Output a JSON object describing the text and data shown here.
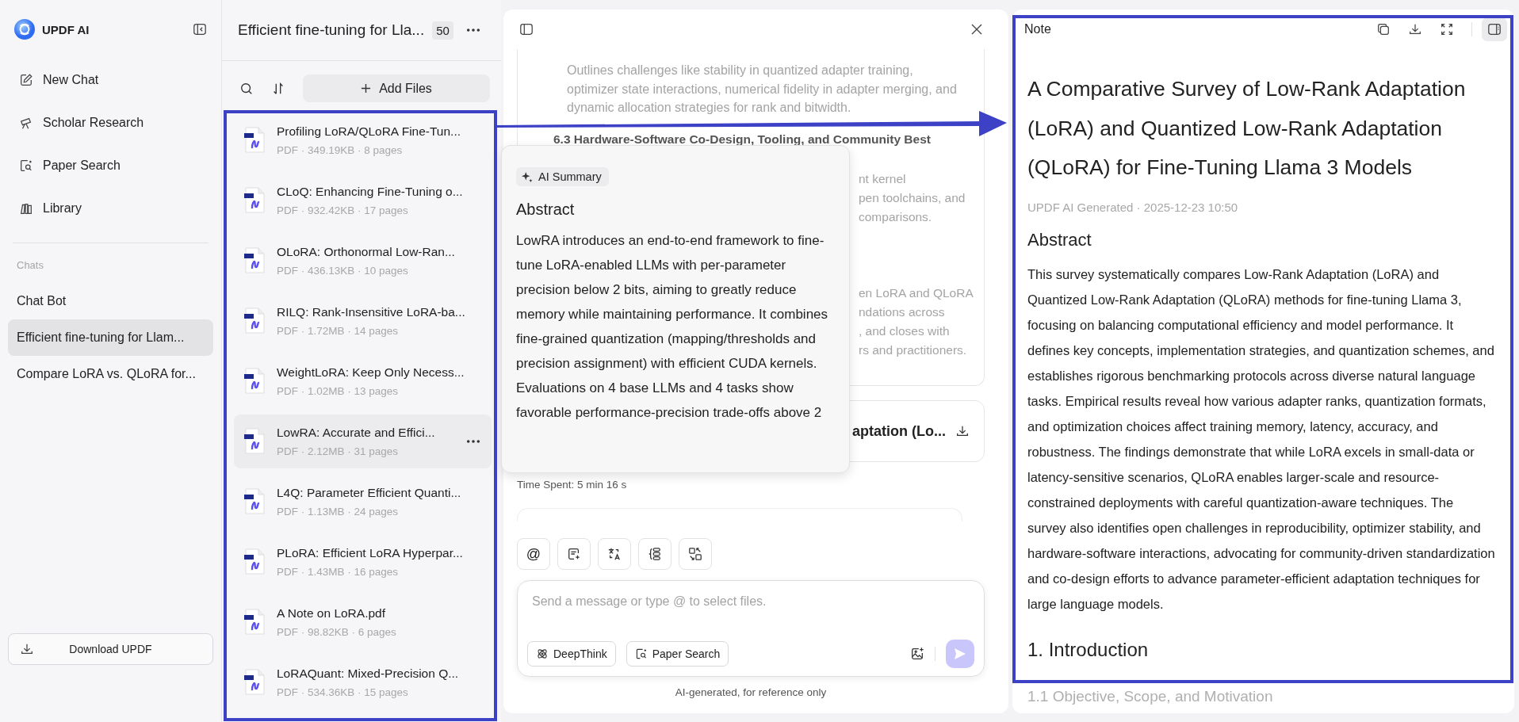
{
  "sidebar": {
    "app_name": "UPDF AI",
    "nav": [
      {
        "label": "New Chat"
      },
      {
        "label": "Scholar Research"
      },
      {
        "label": "Paper Search"
      },
      {
        "label": "Library"
      }
    ],
    "chats_label": "Chats",
    "chats": [
      {
        "label": "Chat Bot",
        "selected": false
      },
      {
        "label": "Efficient fine-tuning for Llam...",
        "selected": true
      },
      {
        "label": "Compare LoRA vs. QLoRA for...",
        "selected": false
      }
    ],
    "download_button": "Download UPDF"
  },
  "file_list": {
    "title": "Efficient fine-tuning for Lla...",
    "count": "50",
    "add_button": "Add Files",
    "files": [
      {
        "name": "Profiling LoRA/QLoRA Fine-Tun...",
        "meta": "PDF · 349.19KB · 8 pages",
        "selected": false
      },
      {
        "name": "CLoQ: Enhancing Fine-Tuning o...",
        "meta": "PDF · 932.42KB · 17 pages",
        "selected": false
      },
      {
        "name": "OLoRA: Orthonormal Low-Ran...",
        "meta": "PDF · 436.13KB · 10 pages",
        "selected": false
      },
      {
        "name": "RILQ: Rank-Insensitive LoRA-ba...",
        "meta": "PDF · 1.72MB · 14 pages",
        "selected": false
      },
      {
        "name": "WeightLoRA: Keep Only Necess...",
        "meta": "PDF · 1.02MB · 13 pages",
        "selected": false
      },
      {
        "name": "LowRA: Accurate and Effici...",
        "meta": "PDF · 2.12MB · 31 pages",
        "selected": true
      },
      {
        "name": "L4Q: Parameter Efficient Quanti...",
        "meta": "PDF · 1.13MB · 24 pages",
        "selected": false
      },
      {
        "name": "PLoRA: Efficient LoRA Hyperpar...",
        "meta": "PDF · 1.43MB · 16 pages",
        "selected": false
      },
      {
        "name": "A Note on LoRA.pdf",
        "meta": "PDF · 98.82KB · 6 pages",
        "selected": false
      },
      {
        "name": "LoRAQuant: Mixed-Precision Q...",
        "meta": "PDF · 534.36KB · 15 pages",
        "selected": false
      }
    ]
  },
  "chat": {
    "faded_text": "Outlines challenges like stability in quantized adapter training, optimizer state interactions, numerical fidelity in adapter merging, and dynamic allocation strategies for rank and bitwidth.",
    "section_heading": "6.3 Hardware-Software Co-Design, Tooling, and Community Best",
    "covered_fragments": [
      [
        "nt kernel",
        "pen toolchains, and",
        "comparisons."
      ],
      [
        "en LoRA and QLoRA",
        "ndations across",
        ", and closes with",
        "rs and practitioners."
      ]
    ],
    "document_title": "aptation (Lo...",
    "time_spent": "Time Spent: 5 min 16 s",
    "tool_buttons": [
      "@"
    ],
    "input": {
      "placeholder": "Send a message or type @ to select files."
    },
    "mode_buttons": [
      "DeepThink",
      "Paper Search"
    ],
    "footer": "AI-generated, for reference only"
  },
  "summary_popup": {
    "chip": "AI Summary",
    "heading": "Abstract",
    "text": "LowRA introduces an end-to-end framework to fine-tune LoRA-enabled LLMs with per-parameter precision below 2 bits, aiming to greatly reduce memory while maintaining performance. It combines fine-grained quantization (mapping/thresholds and precision assignment) with efficient CUDA kernels. Evaluations on 4 base LLMs and 4 tasks show favorable performance-precision trade-offs above 2"
  },
  "note": {
    "label": "Note",
    "title": "A Comparative Survey of Low-Rank Adaptation (LoRA) and Quantized Low-Rank Adaptation (QLoRA) for Fine-Tuning Llama 3 Models",
    "meta": "UPDF AI Generated · 2025-12-23 10:50",
    "sections": [
      {
        "kind": "heading",
        "text": "Abstract"
      },
      {
        "kind": "paragraph",
        "text": "This survey systematically compares Low-Rank Adaptation (LoRA) and Quantized Low-Rank Adaptation (QLoRA) methods for fine-tuning Llama 3, focusing on balancing computational efficiency and model performance. It defines key concepts, implementation strategies, and quantization schemes, and establishes rigorous benchmarking protocols across diverse natural language tasks. Empirical results reveal how various adapter ranks, quantization formats, and optimization choices affect training memory, latency, accuracy, and robustness. The findings demonstrate that while LoRA excels in small-data or latency-sensitive scenarios, QLoRA enables larger-scale and resource-constrained deployments with careful quantization-aware techniques. The survey also identifies open challenges in reproducibility, optimizer stability, and hardware-software interactions, advocating for community-driven standardization and co-design efforts to advance parameter-efficient adaptation techniques for large language models."
      },
      {
        "kind": "section",
        "text": "1. Introduction"
      },
      {
        "kind": "faded",
        "text": "1.1 Objective, Scope, and Motivation"
      }
    ]
  }
}
